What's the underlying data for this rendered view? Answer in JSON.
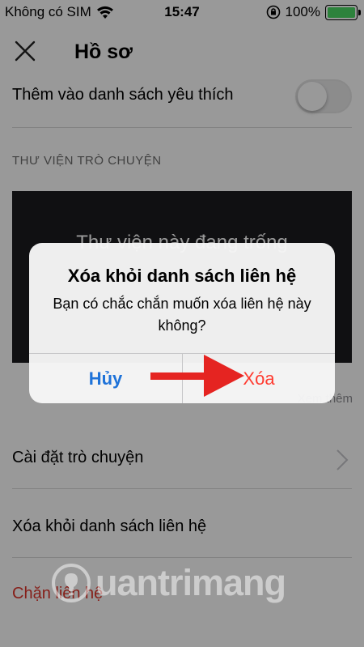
{
  "status_bar": {
    "carrier": "Không có SIM",
    "time": "15:47",
    "battery": "100%"
  },
  "nav": {
    "title": "Hồ sơ"
  },
  "favorites": {
    "label": "Thêm vào danh sách yêu thích",
    "enabled": false
  },
  "library": {
    "header": "THƯ VIỆN TRÒ CHUYỆN",
    "empty_text": "Thư viện này đang trống",
    "see_more": "Xem thêm"
  },
  "rows": {
    "chat_settings": "Cài đặt trò chuyện",
    "remove_contact": "Xóa khỏi danh sách liên hệ",
    "block_contact": "Chặn liên hệ"
  },
  "alert": {
    "title": "Xóa khỏi danh sách liên hệ",
    "message": "Bạn có chắc chắn muốn xóa liên hệ này không?",
    "cancel_label": "Hủy",
    "delete_label": "Xóa"
  },
  "watermark": {
    "text": "uantrimang"
  },
  "colors": {
    "cancel": "#1f73d9",
    "destructive": "#ff3b30",
    "battery_fill": "#4cd964",
    "arrow": "#e52421"
  }
}
